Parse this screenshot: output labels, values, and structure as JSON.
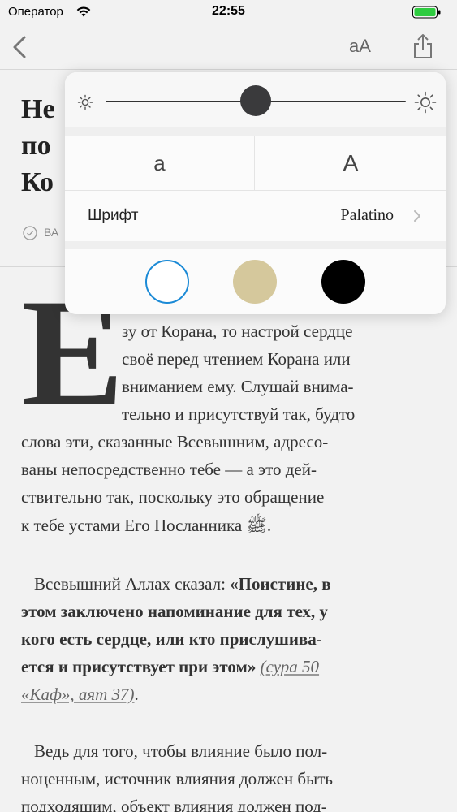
{
  "status_bar": {
    "carrier": "Оператор",
    "time": "22:55"
  },
  "nav": {
    "font_button_label": "aA"
  },
  "article": {
    "title_lines": [
      "Не",
      "по",
      "Ко"
    ],
    "meta_text": "ВА",
    "drop_cap": "Е",
    "paragraph1_lines": [
      "зу от Корана, то настрой сердце",
      "своё перед чтением Корана или",
      "вниманием ему. Слушай внима-",
      "тельно и присутствуй так, будто",
      "слова эти, сказанные Всевышним, адресо-",
      "ваны непосредственно тебе — а это дей-",
      "ствительно так, поскольку это обращение",
      "к тебе устами Его Посланника ﷺ."
    ],
    "paragraph2": {
      "intro": "Всевышний Аллах сказал: ",
      "quote_lines": [
        "«Поистине, в",
        "этом заключено напоминание для тех, у",
        "кого есть сердце, или кто прислушива-",
        "ется и присутствует при этом»"
      ],
      "ref_part1": "(сура 50",
      "ref_part2": "«Каф», аят 37)",
      "end": "."
    },
    "paragraph3_lines": [
      "Ведь для того, чтобы влияние было пол-",
      "ноценным, источник влияния должен быть",
      "подходящим, объект влияния должен под-"
    ]
  },
  "popover": {
    "brightness_level": 0.5,
    "font_size_small_label": "a",
    "font_size_large_label": "A",
    "font_label": "Шрифт",
    "font_value": "Palatino",
    "themes": [
      "white",
      "sepia",
      "night"
    ],
    "selected_theme": "white",
    "colors": {
      "sepia": "#d5c89c",
      "night": "#000000",
      "accent": "#1b8ad6"
    }
  }
}
